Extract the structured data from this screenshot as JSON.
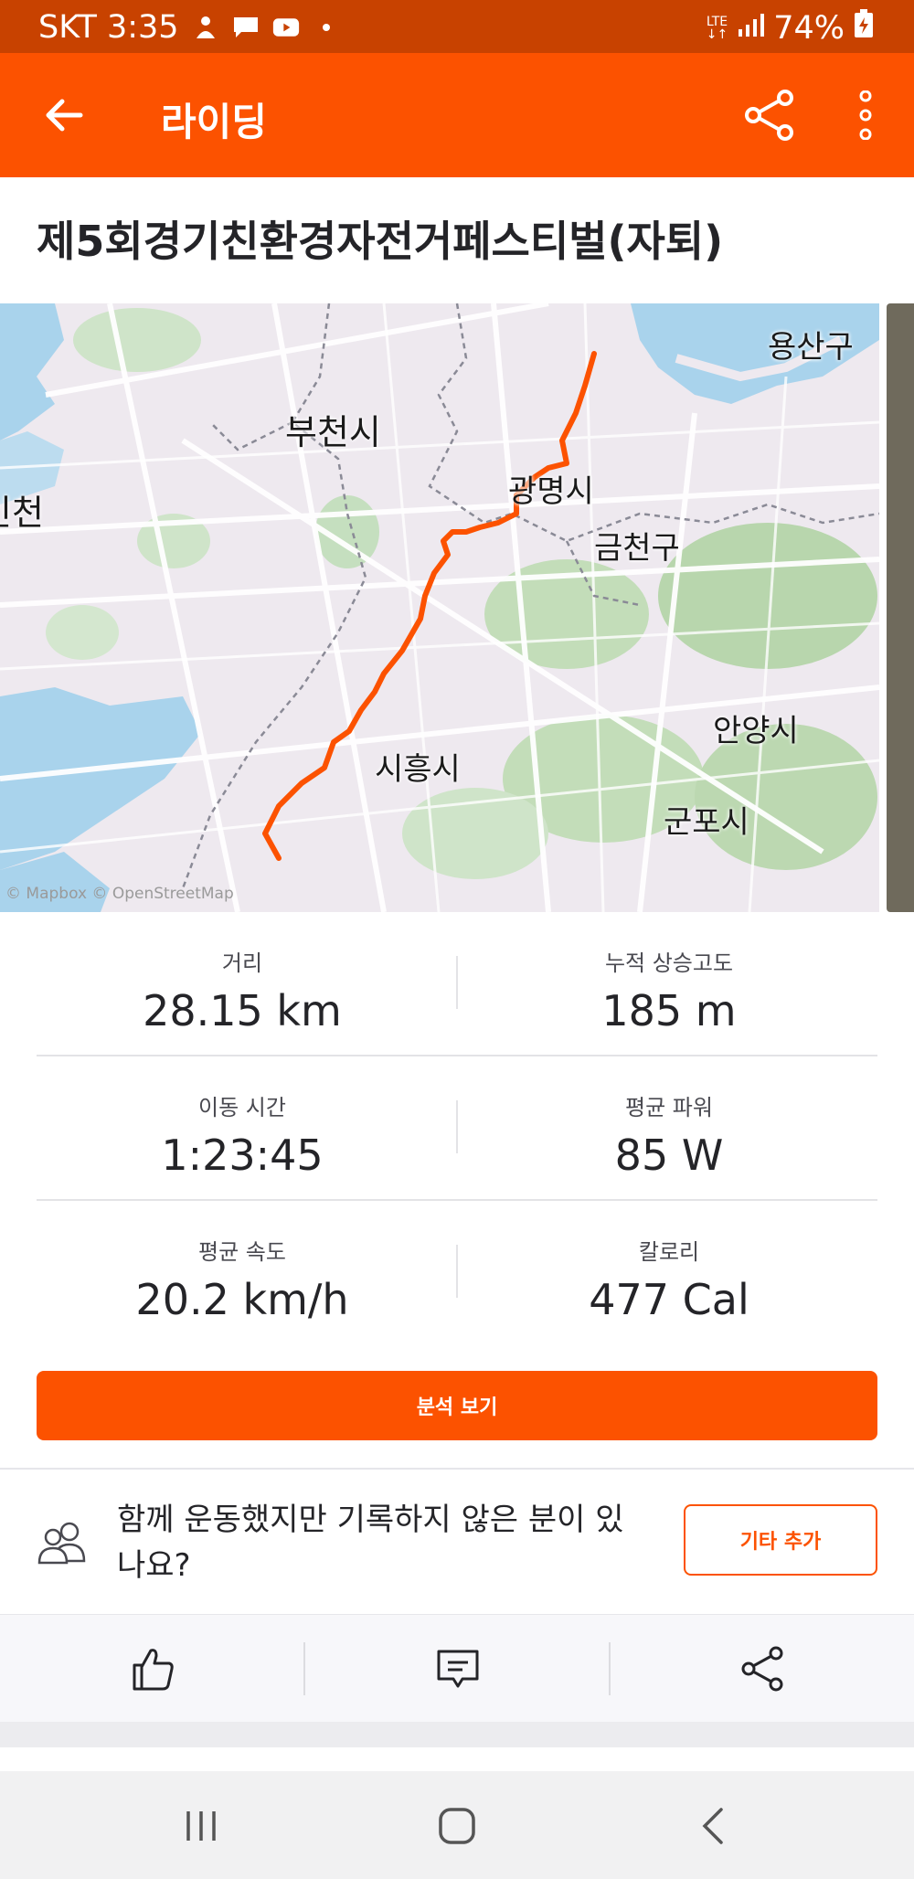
{
  "status_bar": {
    "carrier_time": "SKT 3:35",
    "network": "LTE",
    "battery": "74%"
  },
  "app_bar": {
    "title": "라이딩"
  },
  "activity": {
    "title": "제5회경기친환경자전거페스티벌(자퇴)"
  },
  "map": {
    "labels": [
      "용산구",
      "부천시",
      "인천",
      "광명시",
      "금천구",
      "안양시",
      "시흥시",
      "군포시"
    ],
    "attribution": "© Mapbox © OpenStreetMap",
    "route_color": "#fc5200"
  },
  "stats": [
    {
      "label": "거리",
      "value": "28.15 km"
    },
    {
      "label": "누적 상승고도",
      "value": "185 m"
    },
    {
      "label": "이동 시간",
      "value": "1:23:45"
    },
    {
      "label": "평균 파워",
      "value": "85 W"
    },
    {
      "label": "평균 속도",
      "value": "20.2 km/h"
    },
    {
      "label": "칼로리",
      "value": "477 Cal"
    }
  ],
  "analysis_button": "분석 보기",
  "group_prompt": {
    "text": "함께 운동했지만 기록하지 않은 분이 있나요?",
    "button": "기타 추가"
  },
  "actions": [
    "thumbs-up-icon",
    "comment-icon",
    "share-icon"
  ],
  "colors": {
    "brand": "#fc5200",
    "status_bar": "#c84200"
  }
}
